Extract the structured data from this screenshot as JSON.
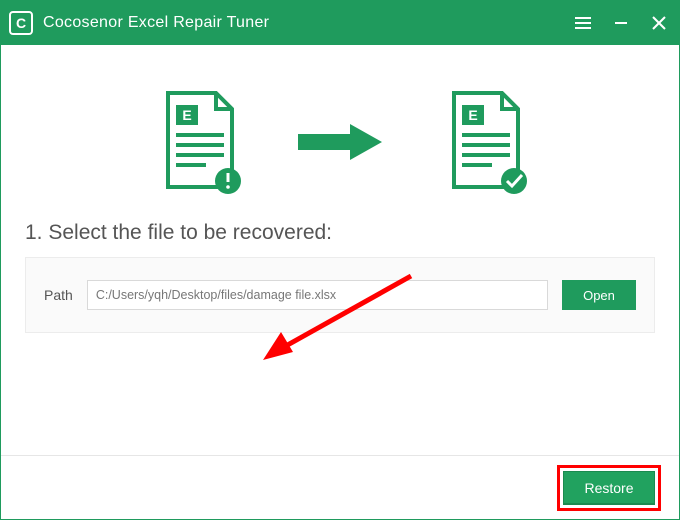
{
  "header": {
    "app_title": "Cocosenor Excel Repair Tuner",
    "logo_letter": "C"
  },
  "illustration": {
    "doc_badge_letter": "E"
  },
  "step": {
    "label": "1. Select the file to be recovered:"
  },
  "path": {
    "label": "Path",
    "value": "C:/Users/yqh/Desktop/files/damage file.xlsx",
    "open_label": "Open"
  },
  "footer": {
    "restore_label": "Restore"
  },
  "colors": {
    "brand_green": "#1f9b5d",
    "highlight_red": "#ff0000"
  }
}
